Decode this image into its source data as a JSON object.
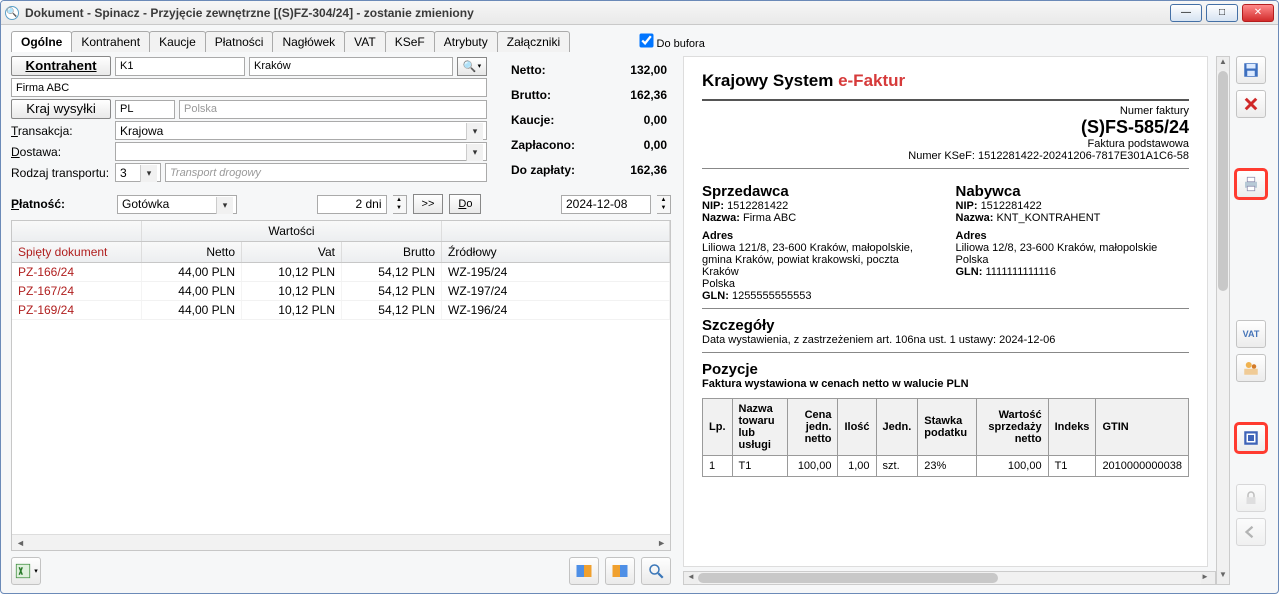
{
  "window": {
    "title": "Dokument - Spinacz - Przyjęcie zewnętrzne [(S)FZ-304/24]  - zostanie zmieniony",
    "minimize_glyph": "—",
    "maximize_glyph": "□",
    "close_glyph": "✕"
  },
  "buffer": {
    "label": "Do bufora",
    "checked": true
  },
  "tabs": [
    "Ogólne",
    "Kontrahent",
    "Kaucje",
    "Płatności",
    "Nagłówek",
    "VAT",
    "KSeF",
    "Atrybuty",
    "Załączniki"
  ],
  "active_tab": "Ogólne",
  "form": {
    "kontrahent_btn": "Kontrahent",
    "kontrahent_code": "K1",
    "kontrahent_city": "Kraków",
    "kontrahent_name": "Firma ABC",
    "krajwysylki_btn": "Kraj wysyłki",
    "krajwysylki_code": "PL",
    "krajwysylki_name": "Polska",
    "transakcja_lbl": "Transakcja:",
    "transakcja_val": "Krajowa",
    "dostawa_lbl": "Dostawa:",
    "dostawa_val": "",
    "rodzaj_lbl": "Rodzaj transportu:",
    "rodzaj_code": "3",
    "rodzaj_name": "Transport drogowy",
    "platnosc_lbl": "Płatność:",
    "platnosc_val": "Gotówka",
    "terms_val": "2 dni",
    "adv_btn": ">>",
    "do_btn": "Do",
    "date_val": "2024-12-08"
  },
  "totals": {
    "rows": [
      {
        "label": "Netto:",
        "value": "132,00"
      },
      {
        "label": "Brutto:",
        "value": "162,36"
      },
      {
        "label": "Kaucje:",
        "value": "0,00"
      },
      {
        "label": "Zapłacono:",
        "value": "0,00"
      },
      {
        "label": "Do zapłaty:",
        "value": "162,36"
      }
    ]
  },
  "grid": {
    "col_doc": "Spięty dokument",
    "super_values": "Wartości",
    "col_netto": "Netto",
    "col_vat": "Vat",
    "col_brutto": "Brutto",
    "col_src": "Źródłowy",
    "rows": [
      {
        "doc": "PZ-166/24",
        "netto": "44,00 PLN",
        "vat": "10,12 PLN",
        "brutto": "54,12 PLN",
        "src": "WZ-195/24"
      },
      {
        "doc": "PZ-167/24",
        "netto": "44,00 PLN",
        "vat": "10,12 PLN",
        "brutto": "54,12 PLN",
        "src": "WZ-197/24"
      },
      {
        "doc": "PZ-169/24",
        "netto": "44,00 PLN",
        "vat": "10,12 PLN",
        "brutto": "54,12 PLN",
        "src": "WZ-196/24"
      }
    ]
  },
  "preview": {
    "title_prefix": "Krajowy System ",
    "title_efak": "e-Faktur",
    "numer_faktury_lbl": "Numer faktury",
    "numer_faktury": "(S)FS-585/24",
    "podtyp": "Faktura podstawowa",
    "ksef_line": "Numer KSeF: 1512281422-20241206-7817E301A1C6-58",
    "sprzedawca_title": "Sprzedawca",
    "sprzedawca": {
      "nip_lbl": "NIP:",
      "nip": "1512281422",
      "nazwa_lbl": "Nazwa:",
      "nazwa": "Firma ABC",
      "adres_lbl": "Adres",
      "adres": "Liliowa 121/8, 23-600 Kraków, małopolskie, gmina Kraków, powiat krakowski, poczta Kraków",
      "polska": "Polska",
      "gln_lbl": "GLN:",
      "gln": "1255555555553"
    },
    "nabywca_title": "Nabywca",
    "nabywca": {
      "nip_lbl": "NIP:",
      "nip": "1512281422",
      "nazwa_lbl": "Nazwa:",
      "nazwa": "KNT_KONTRAHENT",
      "adres_lbl": "Adres",
      "adres": "Liliowa 12/8, 23-600 Kraków, małopolskie",
      "polska": "Polska",
      "gln_lbl": "GLN:",
      "gln": "1111111111116"
    },
    "szczegoly_title": "Szczegóły",
    "szczegoly_text": "Data wystawienia, z zastrzeżeniem art. 106na ust. 1 ustawy: 2024-12-06",
    "pozycje_title": "Pozycje",
    "pozycje_sub": "Faktura wystawiona w cenach netto w walucie PLN",
    "cols": {
      "lp": "Lp.",
      "nazwa": "Nazwa towaru lub usługi",
      "cena": "Cena jedn. netto",
      "ilosc": "Ilość",
      "jedn": "Jedn.",
      "stawka": "Stawka podatku",
      "wartosc": "Wartość sprzedaży netto",
      "indeks": "Indeks",
      "gtin": "GTIN"
    },
    "rows": [
      {
        "lp": "1",
        "nazwa": "T1",
        "cena": "100,00",
        "ilosc": "1,00",
        "jedn": "szt.",
        "stawka": "23%",
        "wartosc": "100,00",
        "indeks": "T1",
        "gtin": "2010000000038"
      }
    ]
  },
  "icons": {
    "save": "floppy",
    "close": "x",
    "print": "printer",
    "vat": "VAT",
    "contacts": "people",
    "ksef": "ksefstamp",
    "lock": "lock",
    "back": "back"
  }
}
